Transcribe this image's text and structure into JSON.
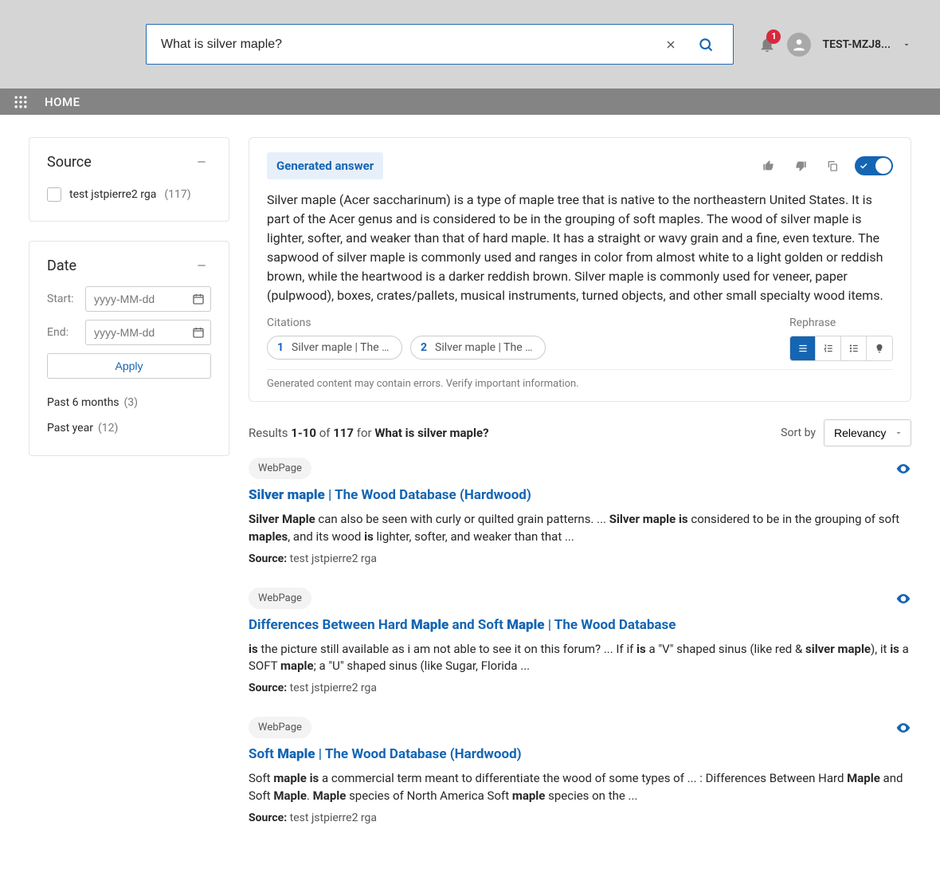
{
  "header": {
    "search_value": "What is silver maple?",
    "notification_count": "1",
    "user_name": "TEST-MZJ8..."
  },
  "nav": {
    "home": "HOME"
  },
  "facets": {
    "source": {
      "title": "Source",
      "items": [
        {
          "label": "test jstpierre2 rga",
          "count": "(117)"
        }
      ]
    },
    "date": {
      "title": "Date",
      "start_label": "Start:",
      "end_label": "End:",
      "placeholder": "yyyy-MM-dd",
      "apply": "Apply",
      "quick": [
        {
          "label": "Past 6 months",
          "count": "(3)"
        },
        {
          "label": "Past year",
          "count": "(12)"
        }
      ]
    }
  },
  "generated": {
    "chip": "Generated answer",
    "body": "Silver maple (Acer saccharinum) is a type of maple tree that is native to the northeastern United States. It is part of the Acer genus and is considered to be in the grouping of soft maples. The wood of silver maple is lighter, softer, and weaker than that of hard maple. It has a straight or wavy grain and a fine, even texture. The sapwood of silver maple is commonly used and ranges in color from almost white to a light golden or reddish brown, while the heartwood is a darker reddish brown. Silver maple is commonly used for veneer, paper (pulpwood), boxes, crates/pallets, musical instruments, turned objects, and other small specialty wood items.",
    "citations_label": "Citations",
    "citations": [
      {
        "num": "1",
        "text": "Silver maple | The W…"
      },
      {
        "num": "2",
        "text": "Silver maple | The W…"
      }
    ],
    "rephrase_label": "Rephrase",
    "disclaimer": "Generated content may contain errors. Verify important information."
  },
  "results_bar": {
    "prefix": "Results ",
    "range": "1-10",
    "of": " of ",
    "total": "117",
    "for": " for ",
    "query": "What is silver maple?",
    "sort_by": "Sort by",
    "sort_value": "Relevancy"
  },
  "results": [
    {
      "type": "WebPage",
      "title_html": "<b>Silver maple</b> | The Wood Database (Hardwood)",
      "snippet_html": "<b>Silver Maple</b> can also be seen with curly or quilted grain patterns. ... <b>Silver maple is</b> considered to be in the grouping of soft <b>maples</b>, and its wood <b>is</b> lighter, softer, and weaker than that ...",
      "source_label": "Source:",
      "source_value": "test jstpierre2 rga"
    },
    {
      "type": "WebPage",
      "title_html": "Differences Between Hard <b>Maple</b> and Soft <b>Maple</b> | The Wood Database",
      "snippet_html": "<b>is</b> the picture still available as i am not able to see it on this forum? ... If if <b>is</b> a \"V\" shaped sinus (like red & <b>silver maple</b>), it <b>is</b> a SOFT <b>maple</b>; a \"U\" shaped sinus (like Sugar, Florida ...",
      "source_label": "Source:",
      "source_value": "test jstpierre2 rga"
    },
    {
      "type": "WebPage",
      "title_html": "Soft <b>Maple</b> | The Wood Database (Hardwood)",
      "snippet_html": "Soft <b>maple is</b> a commercial term meant to differentiate the wood of some types of ... : Differences Between Hard <b>Maple</b> and Soft <b>Maple</b>. <b>Maple</b> species of North America Soft <b>maple</b> species on the ...",
      "source_label": "Source:",
      "source_value": "test jstpierre2 rga"
    }
  ]
}
